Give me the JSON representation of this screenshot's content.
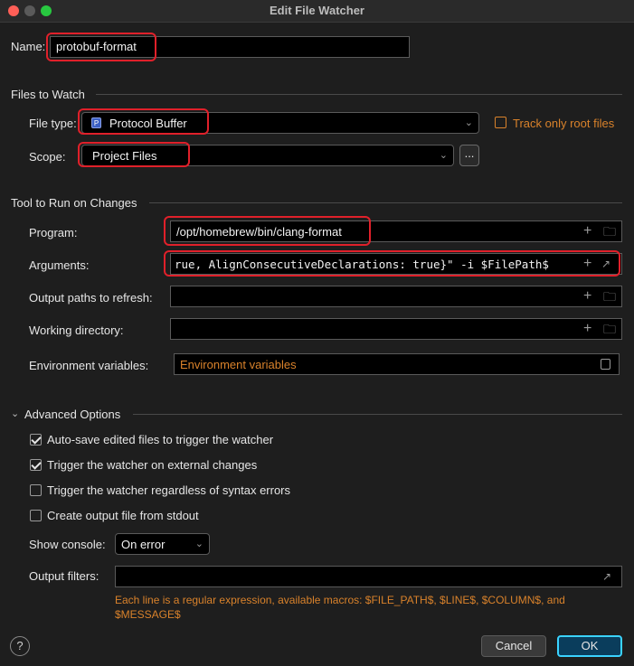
{
  "window": {
    "title": "Edit File Watcher"
  },
  "colors": {
    "accent": "#e0202a",
    "link_orange": "#d9822b",
    "ok_border": "#3ad3ff"
  },
  "name": {
    "label": "Name:",
    "value": "protobuf-format"
  },
  "files_to_watch": {
    "title": "Files to Watch",
    "file_type": {
      "label": "File type:",
      "value": "Protocol Buffer",
      "icon": "protocol-buffer-icon"
    },
    "track_only_root": {
      "label": "Track only root files",
      "checked": false
    },
    "scope": {
      "label": "Scope:",
      "value": "Project Files",
      "browse_label": "..."
    }
  },
  "tool": {
    "title": "Tool to Run on Changes",
    "program": {
      "label": "Program:",
      "value": "/opt/homebrew/bin/clang-format"
    },
    "arguments": {
      "label": "Arguments:",
      "value": "rue, AlignConsecutiveDeclarations: true}\" -i $FilePath$"
    },
    "output_paths": {
      "label": "Output paths to refresh:",
      "value": ""
    },
    "working_dir": {
      "label": "Working directory:",
      "value": ""
    },
    "env_vars": {
      "label": "Environment variables:",
      "placeholder": "Environment variables"
    }
  },
  "advanced": {
    "title": "Advanced Options",
    "options": [
      {
        "label": "Auto-save edited files to trigger the watcher",
        "checked": true
      },
      {
        "label": "Trigger the watcher on external changes",
        "checked": true
      },
      {
        "label": "Trigger the watcher regardless of syntax errors",
        "checked": false
      },
      {
        "label": "Create output file from stdout",
        "checked": false
      }
    ],
    "show_console": {
      "label": "Show console:",
      "value": "On error"
    },
    "output_filters": {
      "label": "Output filters:",
      "value": ""
    },
    "hint": "Each line is a regular expression, available macros: $FILE_PATH$, $LINE$, $COLUMN$, and $MESSAGE$"
  },
  "buttons": {
    "help": "?",
    "cancel": "Cancel",
    "ok": "OK"
  }
}
